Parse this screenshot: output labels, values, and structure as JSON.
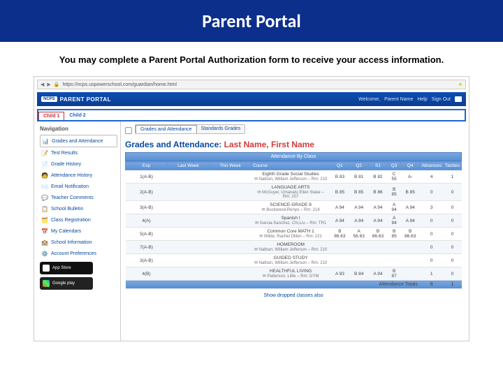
{
  "slide": {
    "title": "Parent Portal",
    "subtitle": "You may complete a Parent Portal Authorization form to receive your access information."
  },
  "url": "https://ncps.uspowerschool.com/guardian/home.html",
  "brand": "PARENT PORTAL",
  "welcome": {
    "label": "Welcome,",
    "name": "Parent Name",
    "help": "Help",
    "signout": "Sign Out"
  },
  "children": [
    "Child 1",
    "Child 2"
  ],
  "nav_header": "Navigation",
  "nav": [
    {
      "label": "Grades and Attendance",
      "icon": "📊"
    },
    {
      "label": "Test Results",
      "icon": "📝"
    },
    {
      "label": "Grade History",
      "icon": "📄"
    },
    {
      "label": "Attendance History",
      "icon": "🧑"
    },
    {
      "label": "Email Notification",
      "icon": "✉️"
    },
    {
      "label": "Teacher Comments",
      "icon": "💬"
    },
    {
      "label": "School Bulletin",
      "icon": "📋"
    },
    {
      "label": "Class Registration",
      "icon": "🗂️"
    },
    {
      "label": "My Calendars",
      "icon": "📅"
    },
    {
      "label": "School Information",
      "icon": "🏫"
    },
    {
      "label": "Account Preferences",
      "icon": "⚙️"
    }
  ],
  "store": {
    "apple": "App Store",
    "google": "Google play"
  },
  "tabs": [
    "Grades and Attendance",
    "Standards Grades"
  ],
  "page_heading": {
    "prefix": "Grades and Attendance: ",
    "student": "Last Name, First Name"
  },
  "band": "Attendance By Class",
  "cols": {
    "exp": "Exp",
    "lw": "Last Week",
    "tw": "This Week",
    "course": "Course",
    "q1": "Q1",
    "q2": "Q2",
    "s1": "S1",
    "q3": "Q3",
    "q4": "Q4",
    "abs": "Absences",
    "tar": "Tardies"
  },
  "rows": [
    {
      "exp": "1(A-B)",
      "course": "Eighth Grade Social Studies",
      "teacher": "Nathan, William Jefferson – Rm: 210",
      "grades": [
        "B 83",
        "B 81",
        "B 82",
        "C 55",
        "A-",
        "4",
        "1"
      ]
    },
    {
      "exp": "2(A-B)",
      "course": "LANGUAGE ARTS",
      "teacher": "McGuyer, Umanatu Ellen Stake – Rm: 207",
      "grades": [
        "B 85",
        "B 85",
        "B 86",
        "B 85",
        "B 85",
        "0",
        "0"
      ]
    },
    {
      "exp": "3(A-B)",
      "course": "SCIENCE-GRADE 8",
      "teacher": "Buckwood-Renyo – Rm: 214",
      "grades": [
        "A 94",
        "A 94",
        "A 94",
        "A 94",
        "A 94",
        "3",
        "0"
      ]
    },
    {
      "exp": "4(A)",
      "course": "Spanish I",
      "teacher": "Garcia-Sanchez, Chi,Liu – Rm: TR1",
      "grades": [
        "A 94",
        "A 94",
        "A 94",
        "A 94",
        "A 94",
        "0",
        "0"
      ]
    },
    {
      "exp": "5(A-B)",
      "course": "Common Core MATH 1",
      "teacher": "Wilde, Rachel Dillon – Rm: 221",
      "grades": [
        "B 86.63",
        "A 56.63",
        "B 86.63",
        "B 85",
        "B 86.63",
        "0",
        "0"
      ]
    },
    {
      "exp": "7(A-B)",
      "course": "HOMEROOM",
      "teacher": "Nathan, William Jefferson – Rm: 210",
      "grades": [
        "",
        "",
        "",
        "",
        "",
        "0",
        "0"
      ]
    },
    {
      "exp": "3(A-B)",
      "course": "GUIDED STUDY",
      "teacher": "Nathan, William Jefferson – Rm: 210",
      "grades": [
        "",
        "",
        "",
        "",
        "",
        "0",
        "0"
      ]
    },
    {
      "exp": "4(B)",
      "course": "HEALTHFUL LIVING",
      "teacher": "Patterson, Lillie – Rm: GYM",
      "grades": [
        "A 93",
        "B 84",
        "A 94",
        "B 87",
        "",
        "1",
        "0"
      ]
    }
  ],
  "totals_label": "Attendance Totals",
  "totals": [
    "8",
    "1"
  ],
  "footer_link": "Show dropped classes also"
}
